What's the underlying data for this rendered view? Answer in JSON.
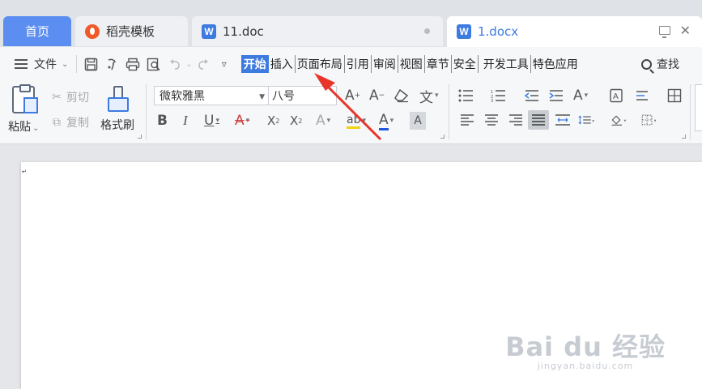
{
  "tabs": [
    {
      "label": "首页"
    },
    {
      "label": "稻壳模板"
    },
    {
      "label": "11.doc"
    },
    {
      "label": "1.docx"
    }
  ],
  "menu": {
    "file_label": "文件",
    "tabs": [
      "开始",
      "插入",
      "页面布局",
      "引用",
      "审阅",
      "视图",
      "章节",
      "安全",
      "开发工具",
      "特色应用"
    ],
    "active_tab": "开始",
    "search_label": "查找"
  },
  "ribbon": {
    "paste": "粘贴",
    "cut": "剪切",
    "copy": "复制",
    "format_painter": "格式刷",
    "font_name": "微软雅黑",
    "font_size": "八号"
  },
  "colors": {
    "accent": "#3d7be0",
    "arrow": "#e8342b"
  },
  "watermark": {
    "main": "Bai du 经验",
    "sub": "jingyan.baidu.com"
  }
}
